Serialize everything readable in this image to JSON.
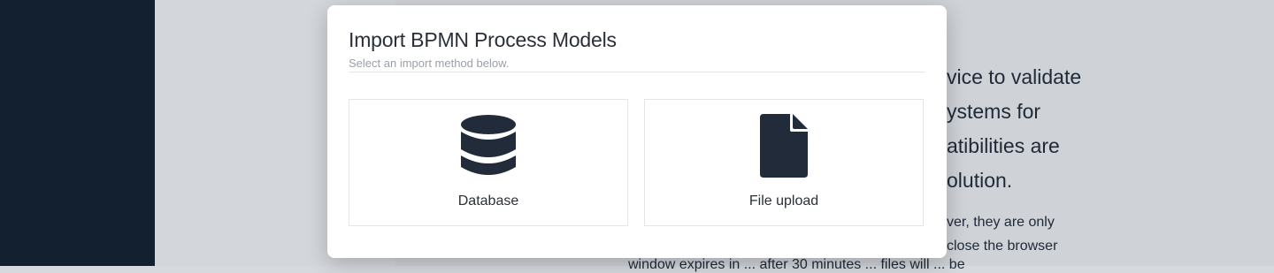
{
  "background": {
    "lines_large": [
      "vice to validate",
      "ystems for",
      "atibilities are",
      "olution."
    ],
    "lines_small": [
      "ver, they are only",
      "close the browser"
    ],
    "partial_bottom": "window  expires  in  ...   after  30 minutes  ...  files will  ...  be"
  },
  "modal": {
    "title": "Import BPMN Process Models",
    "subtitle": "Select an import method below.",
    "options": [
      {
        "label": "Database",
        "icon": "database-icon"
      },
      {
        "label": "File upload",
        "icon": "file-icon"
      }
    ]
  },
  "colors": {
    "sidebar": "#13202f",
    "icon": "#222b3a",
    "text": "#2a2f38"
  }
}
